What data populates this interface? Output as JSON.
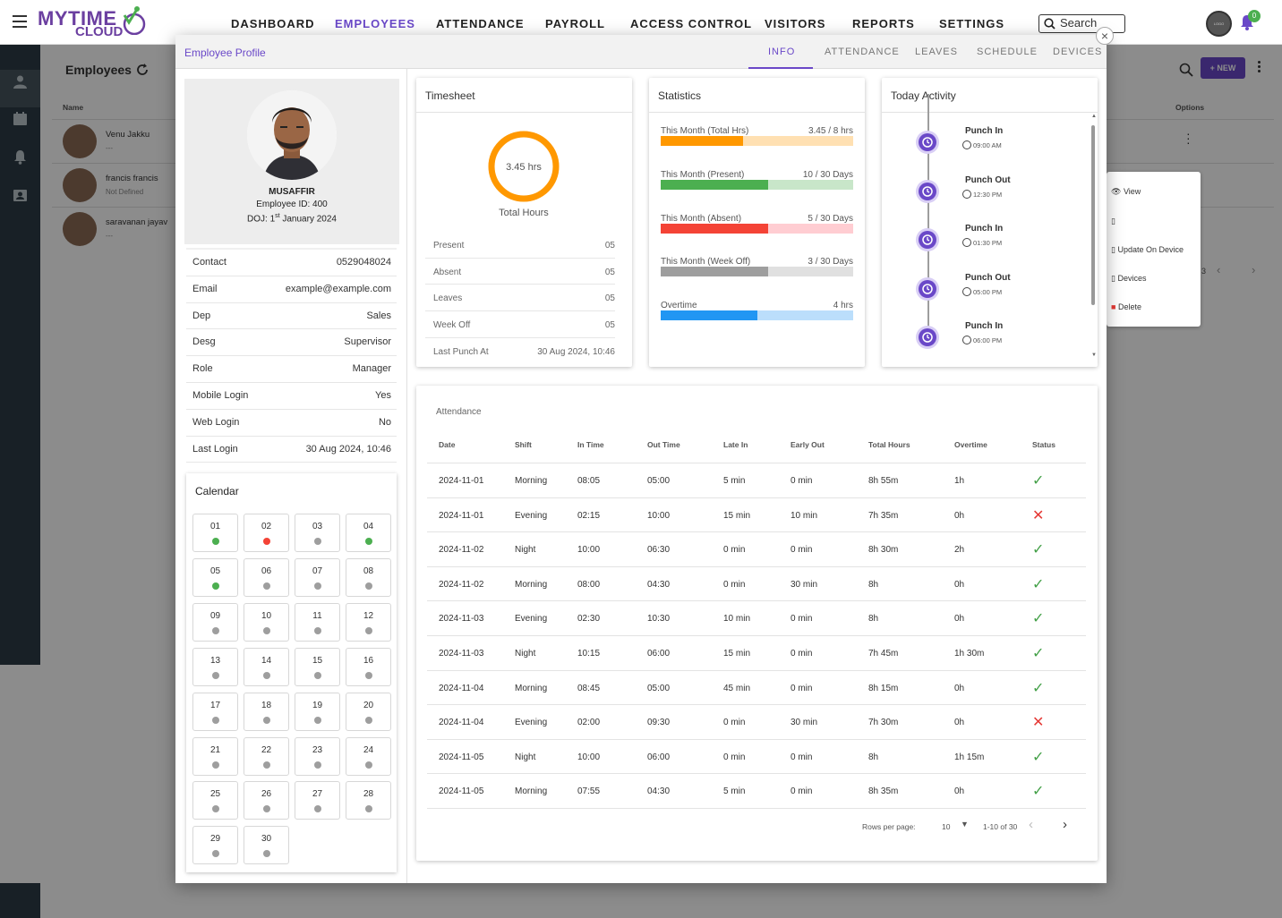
{
  "app": {
    "logo_line1": "MYTIME",
    "logo_line2": "CLOUD",
    "logo_badge": "LOGO"
  },
  "nav": {
    "items": [
      "DASHBOARD",
      "EMPLOYEES",
      "ATTENDANCE",
      "PAYROLL",
      "ACCESS CONTROL",
      "VISITORS",
      "REPORTS",
      "SETTINGS"
    ]
  },
  "search": {
    "label": "Search"
  },
  "notifications": {
    "count": "0"
  },
  "background": {
    "title": "Employees",
    "new_button": "+ NEW",
    "col_name": "Name",
    "col_options": "Options",
    "rows": [
      {
        "name": "Venu Jakku",
        "sub": "---"
      },
      {
        "name": "francis francis",
        "sub": "Not Defined"
      },
      {
        "name": "saravanan jayav",
        "sub": "---"
      }
    ],
    "pager_partial": "3",
    "context_menu": [
      "View",
      "Update On Device",
      "Devices",
      "Delete"
    ]
  },
  "modal": {
    "title": "Employee Profile",
    "close": "×",
    "tabs": [
      "INFO",
      "ATTENDANCE",
      "LEAVES",
      "SCHEDULE",
      "DEVICES"
    ]
  },
  "profile": {
    "name": "MUSAFFIR",
    "employee_id": "Employee ID: 400",
    "doj_prefix": "DOJ: 1",
    "doj_sup": "st",
    "doj_suffix": " January 2024",
    "details": [
      {
        "k": "Contact",
        "v": "0529048024"
      },
      {
        "k": "Email",
        "v": "example@example.com"
      },
      {
        "k": "Dep",
        "v": "Sales"
      },
      {
        "k": "Desg",
        "v": "Supervisor"
      },
      {
        "k": "Role",
        "v": "Manager"
      },
      {
        "k": "Mobile Login",
        "v": "Yes"
      },
      {
        "k": "Web Login",
        "v": "No"
      },
      {
        "k": "Last Login",
        "v": "30 Aug 2024, 10:46"
      }
    ]
  },
  "calendar": {
    "title": "Calendar",
    "days": [
      {
        "d": "01",
        "s": "green"
      },
      {
        "d": "02",
        "s": "red"
      },
      {
        "d": "03",
        "s": "grey"
      },
      {
        "d": "04",
        "s": "green"
      },
      {
        "d": "05",
        "s": "green"
      },
      {
        "d": "06",
        "s": "grey"
      },
      {
        "d": "07",
        "s": "grey"
      },
      {
        "d": "08",
        "s": "grey"
      },
      {
        "d": "09",
        "s": "grey"
      },
      {
        "d": "10",
        "s": "grey"
      },
      {
        "d": "11",
        "s": "grey"
      },
      {
        "d": "12",
        "s": "grey"
      },
      {
        "d": "13",
        "s": "grey"
      },
      {
        "d": "14",
        "s": "grey"
      },
      {
        "d": "15",
        "s": "grey"
      },
      {
        "d": "16",
        "s": "grey"
      },
      {
        "d": "17",
        "s": "grey"
      },
      {
        "d": "18",
        "s": "grey"
      },
      {
        "d": "19",
        "s": "grey"
      },
      {
        "d": "20",
        "s": "grey"
      },
      {
        "d": "21",
        "s": "grey"
      },
      {
        "d": "22",
        "s": "grey"
      },
      {
        "d": "23",
        "s": "grey"
      },
      {
        "d": "24",
        "s": "grey"
      },
      {
        "d": "25",
        "s": "grey"
      },
      {
        "d": "26",
        "s": "grey"
      },
      {
        "d": "27",
        "s": "grey"
      },
      {
        "d": "28",
        "s": "grey"
      },
      {
        "d": "29",
        "s": "grey"
      },
      {
        "d": "30",
        "s": "grey"
      }
    ]
  },
  "timesheet": {
    "title": "Timesheet",
    "ring_value": "3.45 hrs",
    "ring_label": "Total Hours",
    "ring_fraction": 1.0,
    "rows": [
      {
        "k": "Present",
        "v": "05"
      },
      {
        "k": "Absent",
        "v": "05"
      },
      {
        "k": "Leaves",
        "v": "05"
      },
      {
        "k": "Week Off",
        "v": "05"
      },
      {
        "k": "Last Punch At",
        "v": "30 Aug 2024, 10:46"
      }
    ]
  },
  "statistics": {
    "title": "Statistics",
    "rows": [
      {
        "k": "This Month (Total Hrs)",
        "v": "3.45 / 8 hrs",
        "fraction": 0.43,
        "color": "#ff9800",
        "track": "#ffe0b2"
      },
      {
        "k": "This Month (Present)",
        "v": "10 / 30 Days",
        "fraction": 0.56,
        "color": "#4caf50",
        "track": "#c8e6c9"
      },
      {
        "k": "This Month (Absent)",
        "v": "5 / 30 Days",
        "fraction": 0.56,
        "color": "#f44336",
        "track": "#ffcdd2"
      },
      {
        "k": "This Month (Week Off)",
        "v": "3 / 30 Days",
        "fraction": 0.56,
        "color": "#9e9e9e",
        "track": "#e0e0e0"
      },
      {
        "k": "Overtime",
        "v": "4 hrs",
        "fraction": 0.5,
        "color": "#2196f3",
        "track": "#bbdefb"
      }
    ]
  },
  "activity": {
    "title": "Today Activity",
    "items": [
      {
        "title": "Punch In",
        "time": "09:00 AM"
      },
      {
        "title": "Punch Out",
        "time": "12:30 PM"
      },
      {
        "title": "Punch In",
        "time": "01:30 PM"
      },
      {
        "title": "Punch Out",
        "time": "05:00 PM"
      },
      {
        "title": "Punch In",
        "time": "06:00 PM"
      }
    ]
  },
  "attendance": {
    "title": "Attendance",
    "headers": [
      "Date",
      "Shift",
      "In Time",
      "Out Time",
      "Late In",
      "Early Out",
      "Total Hours",
      "Overtime",
      "Status"
    ],
    "rows": [
      [
        "2024-11-01",
        "Morning",
        "08:05",
        "05:00",
        "5 min",
        "0 min",
        "8h 55m",
        "1h",
        "ok"
      ],
      [
        "2024-11-01",
        "Evening",
        "02:15",
        "10:00",
        "15 min",
        "10 min",
        "7h 35m",
        "0h",
        "fail"
      ],
      [
        "2024-11-02",
        "Night",
        "10:00",
        "06:30",
        "0 min",
        "0 min",
        "8h 30m",
        "2h",
        "ok"
      ],
      [
        "2024-11-02",
        "Morning",
        "08:00",
        "04:30",
        "0 min",
        "30 min",
        "8h",
        "0h",
        "ok"
      ],
      [
        "2024-11-03",
        "Evening",
        "02:30",
        "10:30",
        "10 min",
        "0 min",
        "8h",
        "0h",
        "ok"
      ],
      [
        "2024-11-03",
        "Night",
        "10:15",
        "06:00",
        "15 min",
        "0 min",
        "7h 45m",
        "1h 30m",
        "ok"
      ],
      [
        "2024-11-04",
        "Morning",
        "08:45",
        "05:00",
        "45 min",
        "0 min",
        "8h 15m",
        "0h",
        "ok"
      ],
      [
        "2024-11-04",
        "Evening",
        "02:00",
        "09:30",
        "0 min",
        "30 min",
        "7h 30m",
        "0h",
        "fail"
      ],
      [
        "2024-11-05",
        "Night",
        "10:00",
        "06:00",
        "0 min",
        "0 min",
        "8h",
        "1h 15m",
        "ok"
      ],
      [
        "2024-11-05",
        "Morning",
        "07:55",
        "04:30",
        "5 min",
        "0 min",
        "8h 35m",
        "0h",
        "ok"
      ]
    ],
    "rows_per_page_label": "Rows per page:",
    "rows_per_page": "10",
    "range": "1-10 of 30"
  }
}
